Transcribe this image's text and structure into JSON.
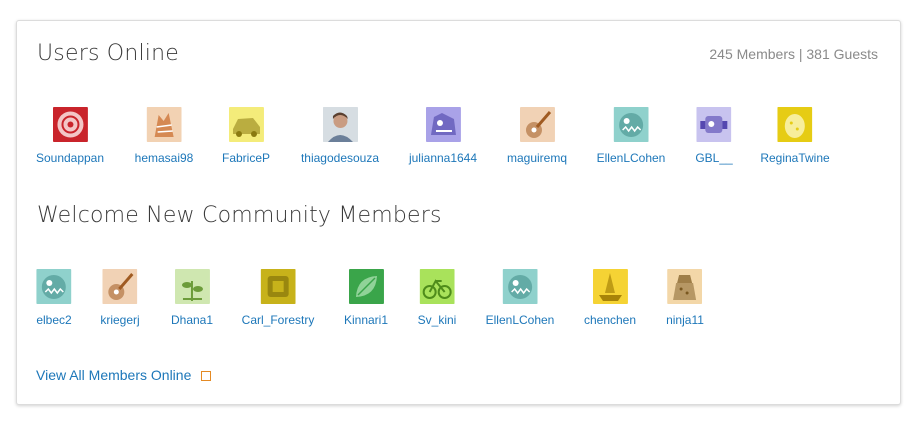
{
  "users_online": {
    "title": "Users Online",
    "stats": "245 Members | 381 Guests",
    "users": [
      {
        "name": "Soundappan",
        "avatar": "speaker-avatar",
        "bg": "#c9242b",
        "fg": "#f3c6c6"
      },
      {
        "name": "hemasai98",
        "avatar": "tiger-avatar",
        "bg": "#f2d2b3",
        "fg": "#c96a2b"
      },
      {
        "name": "FabriceP",
        "avatar": "car-avatar",
        "bg": "#f4ec7a",
        "fg": "#8a7a10"
      },
      {
        "name": "thiagodesouza",
        "avatar": "photo-avatar",
        "bg": "#cfd8de",
        "fg": "#6f5b4e"
      },
      {
        "name": "julianna1644",
        "avatar": "monster-avatar",
        "bg": "#a9a2e8",
        "fg": "#4d43a8"
      },
      {
        "name": "maguiremq",
        "avatar": "guitar-avatar",
        "bg": "#f1d2b5",
        "fg": "#a05b22"
      },
      {
        "name": "EllenLCohen",
        "avatar": "fish-avatar",
        "bg": "#8fd1cc",
        "fg": "#2f7d78"
      },
      {
        "name": "GBL__",
        "avatar": "robot-avatar",
        "bg": "#c8c3ef",
        "fg": "#5548b0"
      },
      {
        "name": "ReginaTwine",
        "avatar": "egg-avatar",
        "bg": "#e6cc14",
        "fg": "#f7ee9b"
      }
    ]
  },
  "new_members": {
    "title": "Welcome New Community Members",
    "users": [
      {
        "name": "elbec2",
        "avatar": "fish-avatar",
        "bg": "#8fd1cc",
        "fg": "#2f7d78"
      },
      {
        "name": "kriegerj",
        "avatar": "guitar-avatar",
        "bg": "#f1d2b5",
        "fg": "#a05b22"
      },
      {
        "name": "Dhana1",
        "avatar": "plant-avatar",
        "bg": "#cfe7b0",
        "fg": "#6c9c3a"
      },
      {
        "name": "Carl_Forestry",
        "avatar": "block-avatar",
        "bg": "#c7b21a",
        "fg": "#7a6a08"
      },
      {
        "name": "Kinnari1",
        "avatar": "leaf-avatar",
        "bg": "#3aa54a",
        "fg": "#b5e7b9"
      },
      {
        "name": "Sv_kini",
        "avatar": "bike-avatar",
        "bg": "#a9e25b",
        "fg": "#4f8c1b"
      },
      {
        "name": "EllenLCohen",
        "avatar": "fish-avatar",
        "bg": "#8fd1cc",
        "fg": "#2f7d78"
      },
      {
        "name": "chenchen",
        "avatar": "ship-avatar",
        "bg": "#f5d334",
        "fg": "#a88408"
      },
      {
        "name": "ninja11",
        "avatar": "dalek-avatar",
        "bg": "#f3d7a8",
        "fg": "#7a5820"
      }
    ]
  },
  "footer": {
    "view_all_label": "View All Members Online",
    "link_color": "#1d77b9",
    "icon_color": "#e48a24"
  }
}
